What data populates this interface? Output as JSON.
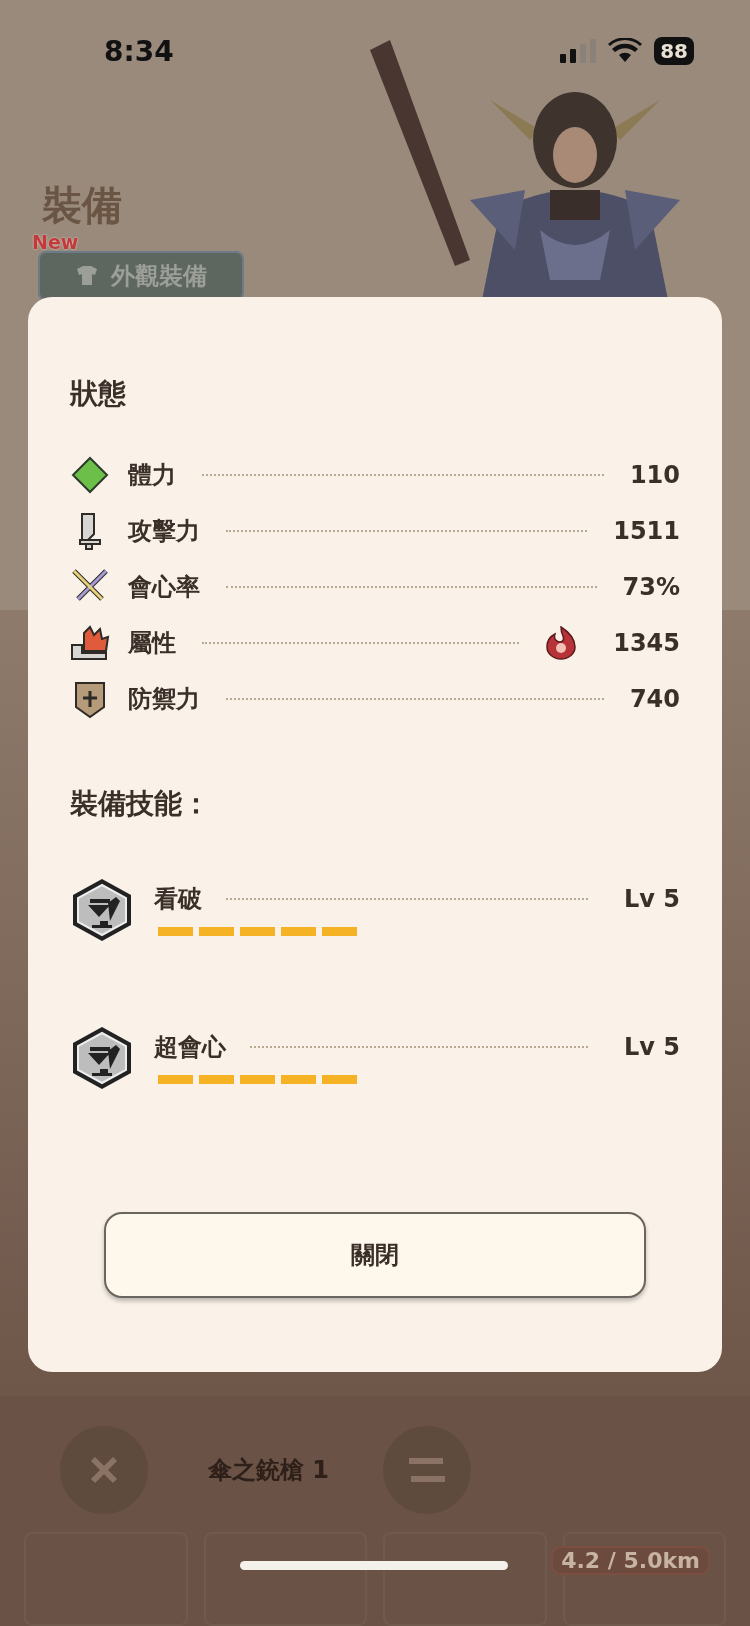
{
  "status_bar": {
    "time": "8:34",
    "battery": "88"
  },
  "header": {
    "title": "裝備",
    "badge": "New",
    "button": "外觀裝備"
  },
  "background": {
    "weapon_label": "傘之銃槍 1",
    "distance": "4.2 / 5.0km"
  },
  "dialog": {
    "title": "狀態",
    "stats": [
      {
        "kind": "health",
        "label": "體力",
        "value": "110"
      },
      {
        "kind": "attack",
        "label": "攻擊力",
        "value": "1511"
      },
      {
        "kind": "crit",
        "label": "會心率",
        "value": "73%"
      },
      {
        "kind": "element",
        "label": "屬性",
        "value": "1345"
      },
      {
        "kind": "defense",
        "label": "防禦力",
        "value": "740"
      }
    ],
    "skills_title": "裝備技能：",
    "skills": [
      {
        "name": "看破",
        "level": "Lv 5",
        "stars": 5
      },
      {
        "name": "超會心",
        "level": "Lv 5",
        "stars": 5
      }
    ],
    "close_button": "關閉"
  }
}
